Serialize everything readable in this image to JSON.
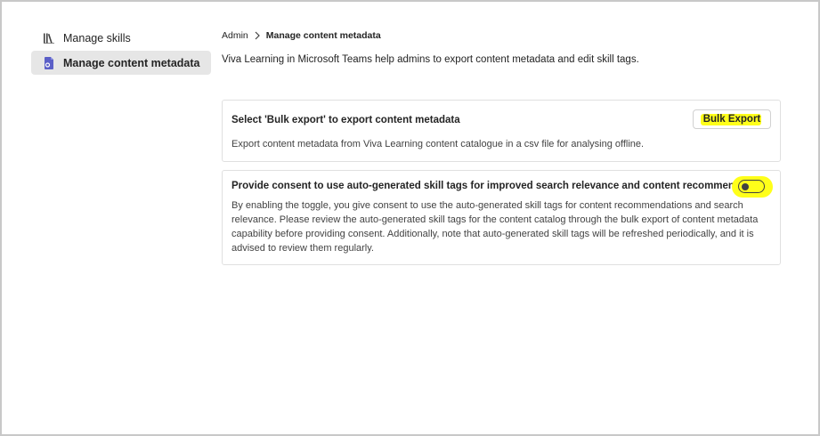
{
  "sidebar": {
    "items": [
      {
        "label": "Manage skills",
        "icon": "library-icon",
        "active": false
      },
      {
        "label": "Manage content metadata",
        "icon": "content-metadata-icon",
        "active": true
      }
    ]
  },
  "breadcrumb": {
    "root": "Admin",
    "current": "Manage content metadata"
  },
  "intro": "Viva Learning in Microsoft Teams help admins to export content metadata and edit skill tags.",
  "export_card": {
    "title": "Select 'Bulk export' to export content metadata",
    "description": "Export content metadata from Viva Learning content catalogue in a csv file for analysing offline.",
    "button_label": "Bulk Export"
  },
  "consent_card": {
    "title": "Provide consent to use auto-generated skill tags for improved search relevance and content recommendations",
    "description": "By enabling the toggle, you give consent to use the auto-generated skill tags for content recommendations and search relevance. Please review the auto-generated skill tags for the content catalog through the bulk export of content metadata capability before providing consent. Additionally, note that auto-generated skill tags will be refreshed periodically, and it is advised to review them regularly.",
    "toggle_on": false
  },
  "colors": {
    "highlight": "#ffff1a",
    "active_nav_bg": "#e6e6e6",
    "icon_accent": "#5b5fc7"
  }
}
